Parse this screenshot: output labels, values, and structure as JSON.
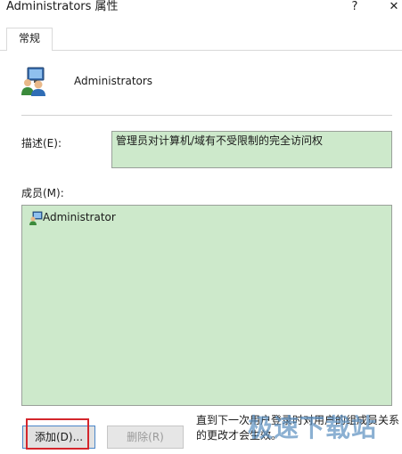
{
  "window": {
    "title": "Administrators 属性",
    "help_glyph": "?",
    "close_glyph": "✕"
  },
  "tabs": [
    {
      "label": "常规",
      "active": true
    }
  ],
  "group": {
    "name": "Administrators",
    "icon": "group-users-icon"
  },
  "description": {
    "label": "描述(E):",
    "value": "管理员对计算机/域有不受限制的完全访问权"
  },
  "members": {
    "label": "成员(M):",
    "items": [
      {
        "name": "Administrator",
        "icon": "user-icon"
      }
    ]
  },
  "buttons": {
    "add": "添加(D)...",
    "remove": "删除(R)"
  },
  "note": "直到下一次用户登录时对用户的组成员关系的更改才会生效。",
  "watermark": "极速下载站",
  "colors": {
    "field_bg": "#cde9cb",
    "highlight": "#d4262c",
    "focus_border": "#4a86c8"
  }
}
